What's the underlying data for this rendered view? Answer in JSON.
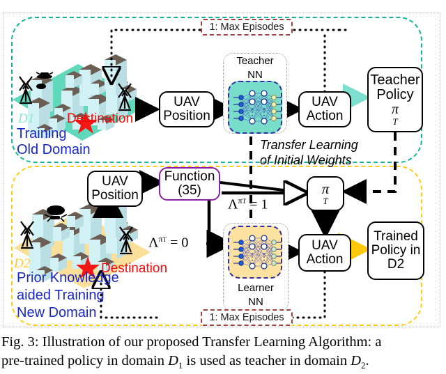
{
  "figure": {
    "caption_line1": "Fig. 3: Illustration of our proposed Transfer Learning Algorithm: a",
    "caption_line2_a": "pre-trained policy in domain ",
    "caption_d1": "D",
    "caption_d1_sub": "1",
    "caption_line2_b": " is used as teacher in domain ",
    "caption_d2": "D",
    "caption_d2_sub": "2",
    "caption_end": "."
  },
  "colors": {
    "teacher_domain_border": "#13b39a",
    "learner_domain_border": "#ffcd14",
    "teacher_nn_fill": "#79ddc9",
    "learner_nn_fill": "#fbe2a0",
    "nn_border": "#2f2fa2",
    "episode_chip_border": "#a14040",
    "function_box_border": "#8a1fa8",
    "destination_text": "#fb0a0a",
    "domain_label_text": "#1a27c4",
    "teacher_ground": "#5fd8bb",
    "learner_ground": "#fadf9b",
    "building_face": "#d2f1f5",
    "building_roof": "#6b5f55"
  },
  "top_domain": {
    "episode_chip": "1: Max Episodes",
    "scene_label_id": "D1",
    "scene_label_line1": "Training",
    "scene_label_line2": "Old Domain",
    "destination_label": "Destination",
    "uav_position": {
      "line1": "UAV",
      "line2": "Position"
    },
    "nn_title_line1": "Teacher",
    "nn_title_line2": "NN",
    "uav_action": {
      "line1": "UAV",
      "line2": "Action"
    },
    "policy": {
      "line1": "Teacher",
      "line2": "Policy",
      "line3": "π",
      "line3_sub": "T"
    }
  },
  "transfer": {
    "line1": "Transfer Learning",
    "line2": "of Initial Weights"
  },
  "bottom_domain": {
    "episode_chip": "1: Max Episodes",
    "scene_label_id": "D2",
    "scene_label_line1": "Prior Knowledge",
    "scene_label_line2": "aided Training",
    "scene_label_line3": "New Domain",
    "destination_label": "Destination",
    "uav_position": {
      "line1": "UAV",
      "line2": "Position"
    },
    "function_box": {
      "line1": "Function",
      "line2": "(35)"
    },
    "lambda_zero": {
      "sym": "Λ",
      "sup": "π",
      "sup_sub": "T",
      "eq": "= 0"
    },
    "lambda_one": {
      "sym": "Λ",
      "sup": "π",
      "sup_sub": "T",
      "eq": "= 1"
    },
    "pi_t": {
      "sym": "π",
      "sub": "T"
    },
    "nn_title_line1": "Learner",
    "nn_title_line2": "NN",
    "uav_action": {
      "line1": "UAV",
      "line2": "Action"
    },
    "trained_policy": {
      "line1": "Trained",
      "line2": "Policy in",
      "line3": "D2"
    }
  }
}
